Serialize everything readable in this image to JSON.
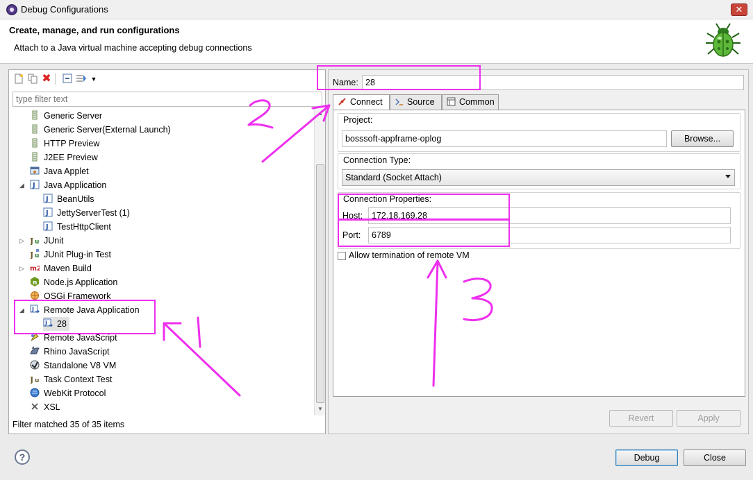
{
  "window": {
    "title": "Debug Configurations",
    "close_label": "✕"
  },
  "banner": {
    "heading": "Create, manage, and run configurations",
    "subtitle": "Attach to a Java virtual machine accepting debug connections"
  },
  "left": {
    "filter_placeholder": "type filter text",
    "status": "Filter matched 35 of 35 items",
    "tree": [
      {
        "label": "Generic Server",
        "icon": "server-icon"
      },
      {
        "label": "Generic Server(External Launch)",
        "icon": "server-icon"
      },
      {
        "label": "HTTP Preview",
        "icon": "server-icon"
      },
      {
        "label": "J2EE Preview",
        "icon": "server-icon"
      },
      {
        "label": "Java Applet",
        "icon": "applet-icon"
      },
      {
        "label": "Java Application",
        "icon": "java-app-icon",
        "expanded": true
      },
      {
        "label": "BeanUtils",
        "icon": "java-app-icon"
      },
      {
        "label": "JettyServerTest (1)",
        "icon": "java-app-icon"
      },
      {
        "label": "TestHttpClient",
        "icon": "java-app-icon"
      },
      {
        "label": "JUnit",
        "icon": "junit-icon",
        "collapsed": true
      },
      {
        "label": "JUnit Plug-in Test",
        "icon": "junit-plugin-icon"
      },
      {
        "label": "Maven Build",
        "icon": "maven-icon",
        "collapsed": true
      },
      {
        "label": "Node.js Application",
        "icon": "nodejs-icon"
      },
      {
        "label": "OSGi Framework",
        "icon": "osgi-icon"
      },
      {
        "label": "Remote Java Application",
        "icon": "remote-java-icon",
        "expanded": true
      },
      {
        "label": "28",
        "icon": "remote-java-icon",
        "selected": true
      },
      {
        "label": "Remote JavaScript",
        "icon": "remote-js-icon"
      },
      {
        "label": "Rhino JavaScript",
        "icon": "rhino-icon"
      },
      {
        "label": "Standalone V8 VM",
        "icon": "v8-icon"
      },
      {
        "label": "Task Context Test",
        "icon": "task-test-icon"
      },
      {
        "label": "WebKit Protocol",
        "icon": "webkit-icon"
      },
      {
        "label": "XSL",
        "icon": "xsl-icon"
      }
    ]
  },
  "right": {
    "name_label": "Name:",
    "name_value": "28",
    "tabs": [
      {
        "label": "Connect",
        "active": true
      },
      {
        "label": "Source",
        "active": false
      },
      {
        "label": "Common",
        "active": false
      }
    ],
    "project_label": "Project:",
    "project_value": "bosssoft-appframe-oplog",
    "browse_label": "Browse...",
    "connection_type_label": "Connection Type:",
    "connection_type_value": "Standard (Socket Attach)",
    "connection_props_label": "Connection Properties:",
    "host_label": "Host:",
    "host_value": "172.18.169.28",
    "port_label": "Port:",
    "port_value": "6789",
    "allow_termination_label": "Allow termination of remote VM",
    "allow_termination_checked": false,
    "revert_label": "Revert",
    "apply_label": "Apply"
  },
  "footer": {
    "help_label": "?",
    "debug_label": "Debug",
    "close_label": "Close"
  },
  "annotations": {
    "color": "#ee2fee",
    "marks": [
      "1",
      "2",
      "3"
    ]
  }
}
